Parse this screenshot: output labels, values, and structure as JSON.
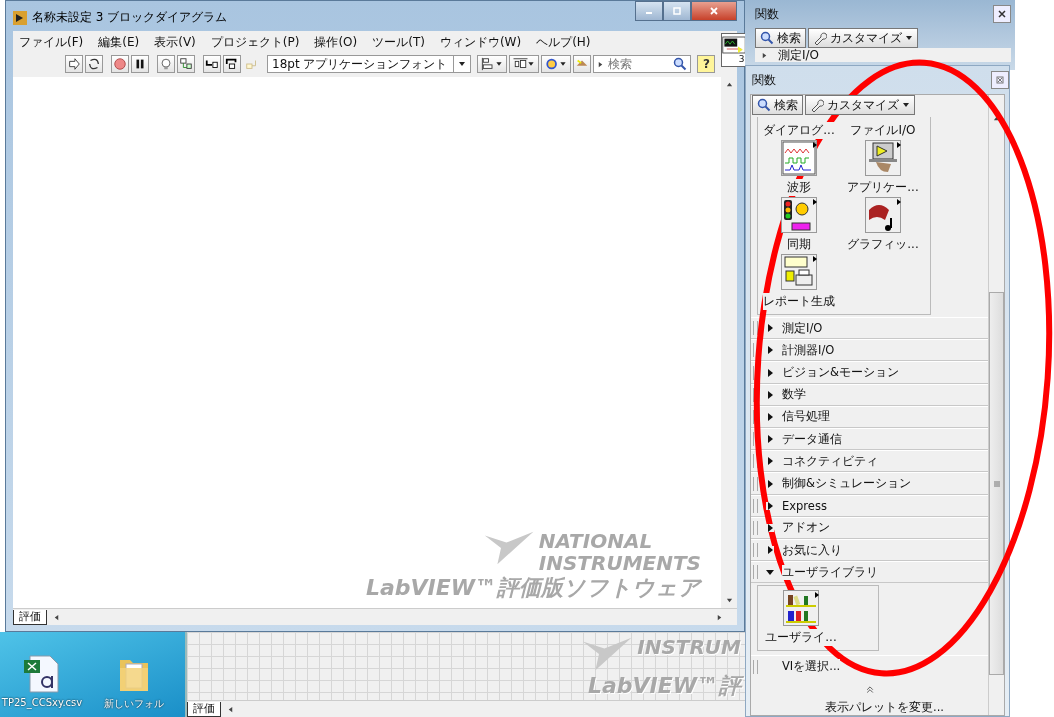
{
  "main_window": {
    "title": "名称未設定 3 ブロックダイアグラム",
    "menu": [
      "ファイル(F)",
      "編集(E)",
      "表示(V)",
      "プロジェクト(P)",
      "操作(O)",
      "ツール(T)",
      "ウィンドウ(W)",
      "ヘルプ(H)"
    ],
    "toolbar": {
      "font": "18pt アプリケーションフォント",
      "search_placeholder": "検索",
      "help": "?"
    },
    "connector_pane": "3",
    "watermark": {
      "line_1": "NATIONAL",
      "line_2": "INSTRUMENTS",
      "product": "LabVIEW™評価版ソフトウェア"
    },
    "status_tab": "評価"
  },
  "desktop_icons": [
    {
      "label": "TP25_CCSxy.csv",
      "kind": "csv"
    },
    {
      "label": "新しいフォル",
      "kind": "folder"
    }
  ],
  "back_window": {
    "watermark": {
      "line_2": "INSTRUM",
      "product": "LabVIEW™評"
    },
    "status_tab": "評価"
  },
  "back_palette": {
    "title": "関数",
    "search_button": "検索",
    "customize_button": "カスタマイズ",
    "first_row": "測定I/O"
  },
  "palette": {
    "title": "関数",
    "search_button": "検索",
    "customize_button": "カスタマイズ",
    "icons": [
      {
        "label": "ダイアログ...",
        "kind": "hidden"
      },
      {
        "label": "ファイルI/O",
        "kind": "hidden"
      },
      {
        "label": "波形",
        "kind": "waveform"
      },
      {
        "label": "アプリケー...",
        "kind": "app"
      },
      {
        "label": "同期",
        "kind": "sync"
      },
      {
        "label": "グラフィッ...",
        "kind": "graphics"
      },
      {
        "label": "レポート生成",
        "kind": "report"
      }
    ],
    "categories": [
      {
        "label": "測定I/O",
        "expanded": false
      },
      {
        "label": "計測器I/O",
        "expanded": false
      },
      {
        "label": "ビジョン&モーション",
        "expanded": false
      },
      {
        "label": "数学",
        "expanded": false
      },
      {
        "label": "信号処理",
        "expanded": false
      },
      {
        "label": "データ通信",
        "expanded": false
      },
      {
        "label": "コネクティビティ",
        "expanded": false
      },
      {
        "label": "制御&シミュレーション",
        "expanded": false
      },
      {
        "label": "Express",
        "expanded": false
      },
      {
        "label": "アドオン",
        "expanded": false
      },
      {
        "label": "お気に入り",
        "expanded": false
      },
      {
        "label": "ユーザライブラリ",
        "expanded": true,
        "icons": [
          {
            "label": "ユーザライ...",
            "kind": "userlib"
          }
        ]
      }
    ],
    "select_vi": "VIを選択...",
    "change_palette": "表示パレットを変更..."
  }
}
